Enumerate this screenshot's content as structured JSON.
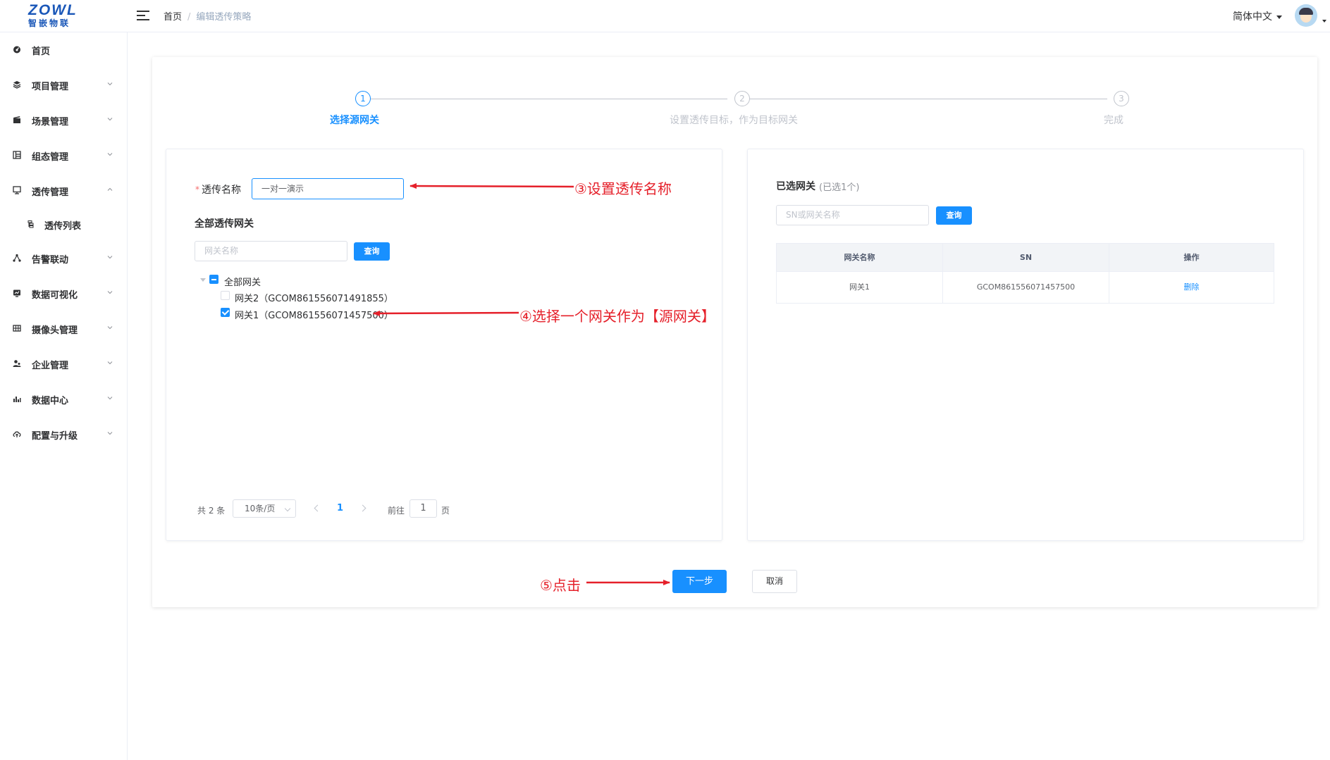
{
  "logo": {
    "brand_en": "ZOWL",
    "brand_cn": "智嵌物联"
  },
  "header": {
    "breadcrumb_home": "首页",
    "breadcrumb_sep": "/",
    "breadcrumb_current": "编辑透传策略",
    "language": "简体中文"
  },
  "sidebar": {
    "items": [
      {
        "label": "首页",
        "icon": "dashboard-icon"
      },
      {
        "label": "项目管理",
        "icon": "layers-icon"
      },
      {
        "label": "场景管理",
        "icon": "clapperboard-icon"
      },
      {
        "label": "组态管理",
        "icon": "grid-layout-icon"
      },
      {
        "label": "透传管理",
        "icon": "monitor-icon"
      },
      {
        "label": "透传列表",
        "icon": "list-icon"
      },
      {
        "label": "告警联动",
        "icon": "network-icon"
      },
      {
        "label": "数据可视化",
        "icon": "chart-icon"
      },
      {
        "label": "摄像头管理",
        "icon": "camera-grid-icon"
      },
      {
        "label": "企业管理",
        "icon": "user-group-icon"
      },
      {
        "label": "数据中心",
        "icon": "bar-chart-icon"
      },
      {
        "label": "配置与升级",
        "icon": "cloud-upload-icon"
      }
    ]
  },
  "steps": [
    {
      "num": "1",
      "title": "选择源网关",
      "state": "active"
    },
    {
      "num": "2",
      "title": "设置透传目标，作为目标网关",
      "state": "wait"
    },
    {
      "num": "3",
      "title": "完成",
      "state": "wait"
    }
  ],
  "form": {
    "required_mark": "*",
    "name_label": "透传名称",
    "name_value": "一对一演示",
    "all_gateways_title": "全部透传网关",
    "search_placeholder": "网关名称",
    "search_button": "查询"
  },
  "tree": {
    "root": "全部网关",
    "children": [
      {
        "label": "网关2（GCOM861556071491855）",
        "checked": false
      },
      {
        "label": "网关1（GCOM861556071457500）",
        "checked": true
      }
    ]
  },
  "pagination": {
    "total_text": "共 2 条",
    "page_size": "10条/页",
    "current_page": "1",
    "goto_prefix": "前往",
    "goto_value": "1",
    "goto_suffix": "页"
  },
  "selected": {
    "title": "已选网关",
    "count_text": "(已选1个)",
    "search_placeholder": "SN或网关名称",
    "search_button": "查询",
    "columns": [
      "网关名称",
      "SN",
      "操作"
    ],
    "rows": [
      {
        "name": "网关1",
        "sn": "GCOM861556071457500",
        "action": "删除"
      }
    ]
  },
  "footer": {
    "next_button": "下一步",
    "cancel_button": "取消"
  },
  "annotations": {
    "a3": "③设置透传名称",
    "a4": "④选择一个网关作为【源网关】",
    "a5": "⑤点击"
  },
  "colors": {
    "primary": "#1890ff",
    "annotation": "#e5202a",
    "required": "#f56c6c"
  }
}
